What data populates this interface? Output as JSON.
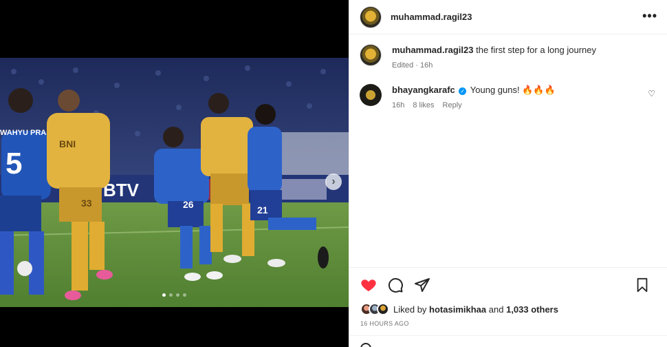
{
  "post": {
    "author": "muhammad.ragil23",
    "caption": "the first step for a long journey",
    "edited_label": "Edited",
    "edited_time": "16h",
    "carousel_dots": 4,
    "active_dot": 1
  },
  "comments": [
    {
      "username": "bhayangkarafc",
      "verified": true,
      "text": "Young guns! 🔥🔥🔥",
      "time": "16h",
      "likes": "8 likes",
      "reply_label": "Reply"
    }
  ],
  "likes": {
    "prefix": "Liked by",
    "first_liker": "hotasimikhaa",
    "and_label": "and",
    "others": "1,033 others"
  },
  "timestamp": "16 HOURS AGO",
  "photo": {
    "banner_text": "BTV",
    "jersey_numbers": [
      "5",
      "33",
      "26",
      "21"
    ],
    "sponsor": "BNI",
    "player_name": "WAHYU PRASET"
  },
  "icons": {
    "more": "more-options-icon",
    "like": "heart-filled-icon",
    "comment": "comment-icon",
    "share": "share-icon",
    "save": "bookmark-icon",
    "next": "chevron-right-icon"
  },
  "colors": {
    "like_red": "#ff3040",
    "verified_blue": "#0095f6",
    "secondary_text": "#737373"
  }
}
